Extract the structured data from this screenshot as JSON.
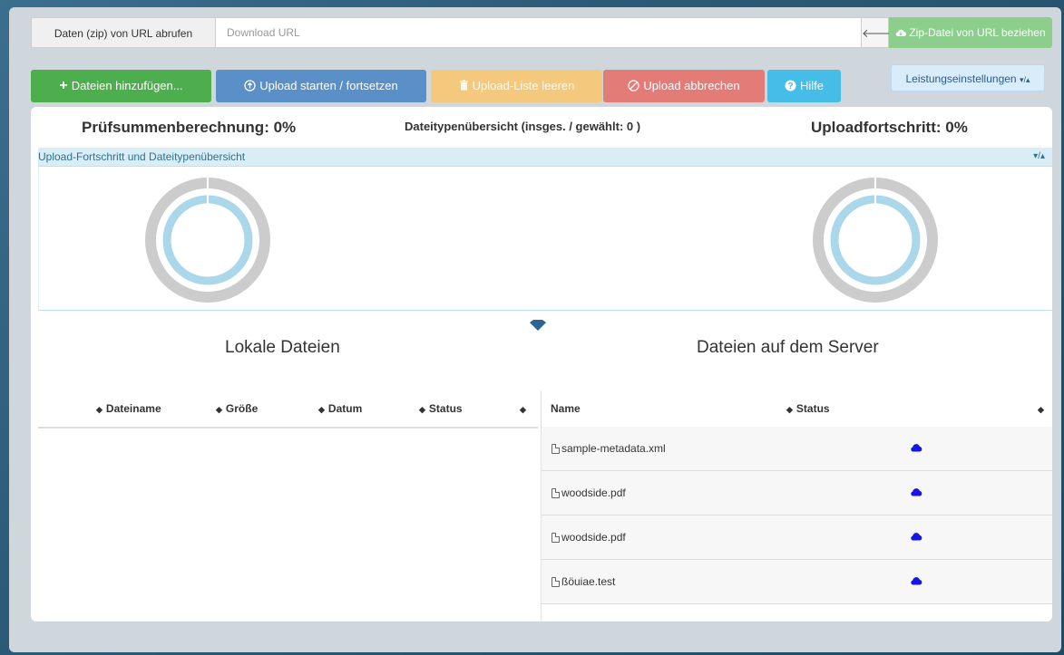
{
  "url_bar": {
    "label": "Daten (zip) von URL abrufen",
    "placeholder": "Download URL",
    "back_icon": "arrow-left-icon",
    "zip_button": "Zip-Datei von URL beziehen",
    "zip_icon": "cloud-download-icon"
  },
  "toolbar": {
    "add_files": "Dateien hinzufügen...",
    "start_upload": "Upload starten / fortsetzen",
    "clear_list": "Upload-Liste leeren",
    "cancel_upload": "Upload abbrechen",
    "help": "Hilfe",
    "performance": "Leistungseinstellungen",
    "colors": {
      "add": "#4cae4c",
      "start": "#5b8fc7",
      "clear": "#f4c97e",
      "cancel": "#e37b76",
      "help": "#45bde8"
    }
  },
  "progress": {
    "checksum_label": "Prüfsummenberechnung: 0%",
    "checksum_percent": 0,
    "filetypes_label": "Dateitypenübersicht (insges. / gewählt: 0 )",
    "upload_label": "Uploadfortschritt: 0%",
    "upload_percent": 0,
    "section_title": "Upload-Fortschritt und Dateitypenübersicht",
    "section_toggle": "▾/▴"
  },
  "local": {
    "title": "Lokale Dateien",
    "columns": [
      "Dateiname",
      "Größe",
      "Datum",
      "Status"
    ],
    "rows": []
  },
  "server": {
    "title": "Dateien auf dem Server",
    "columns": [
      "Name",
      "Status"
    ],
    "rows": [
      {
        "name": "sample-metadata.xml",
        "status_icon": "cloud-icon"
      },
      {
        "name": "woodside.pdf",
        "status_icon": "cloud-icon"
      },
      {
        "name": "woodside.pdf",
        "status_icon": "cloud-icon"
      },
      {
        "name": "ßöuiae.test",
        "status_icon": "cloud-icon"
      }
    ]
  }
}
